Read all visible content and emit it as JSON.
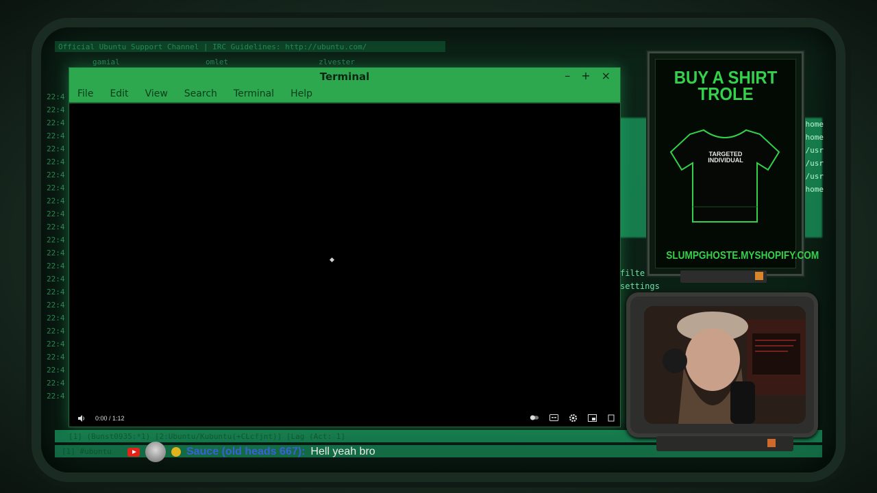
{
  "background": {
    "irc_header": "Official Ubuntu Support Channel | IRC Guidelines: http://ubuntu.com/",
    "irc_users": [
      "gamial",
      "omlet",
      "zlvester"
    ],
    "timestamps": [
      "22:4",
      "22:4",
      "22:4",
      "22:4",
      "22:4",
      "22:4",
      "22:4",
      "22:4",
      "22:4",
      "22:4",
      "22:4",
      "22:4",
      "22:4",
      "22:4",
      "22:4",
      "22:4",
      "22:4",
      "22:4",
      "22:4",
      "22:4",
      "22:4",
      "22:4",
      "22:4",
      "22:4"
    ],
    "right_paths": [
      "/home",
      "/home",
      "/usr",
      "/usr",
      "/usr",
      "/home"
    ],
    "side_words": [
      "filte",
      "settings"
    ],
    "status_line": "[1] (Bunst0935:*1) [2:Ubuntu/Kubuntu(+CLcfjnt)] [Lag (Act: 1]",
    "status_line2": "[1] #ubuntu"
  },
  "terminal": {
    "title": "Terminal",
    "menu": [
      "File",
      "Edit",
      "View",
      "Search",
      "Terminal",
      "Help"
    ],
    "controls": {
      "minimize": "–",
      "maximize": "+",
      "close": "×"
    },
    "video": {
      "time": "0:00 / 1:12"
    }
  },
  "ad": {
    "title_line1": "BUY A SHIRT",
    "title_line2": "TROLE",
    "shirt_line1": "TARGETED",
    "shirt_line2": "INDIVIDUAL",
    "url": "SLUMPGHOSTE.MYSHOPIFY.COM"
  },
  "chat": {
    "user": "Sauce (old heads 667):",
    "message": "Hell yeah bro"
  },
  "colors": {
    "terminal_bar": "#2da84f",
    "ad_green": "#36d14c",
    "chat_user": "#3a60d8"
  }
}
